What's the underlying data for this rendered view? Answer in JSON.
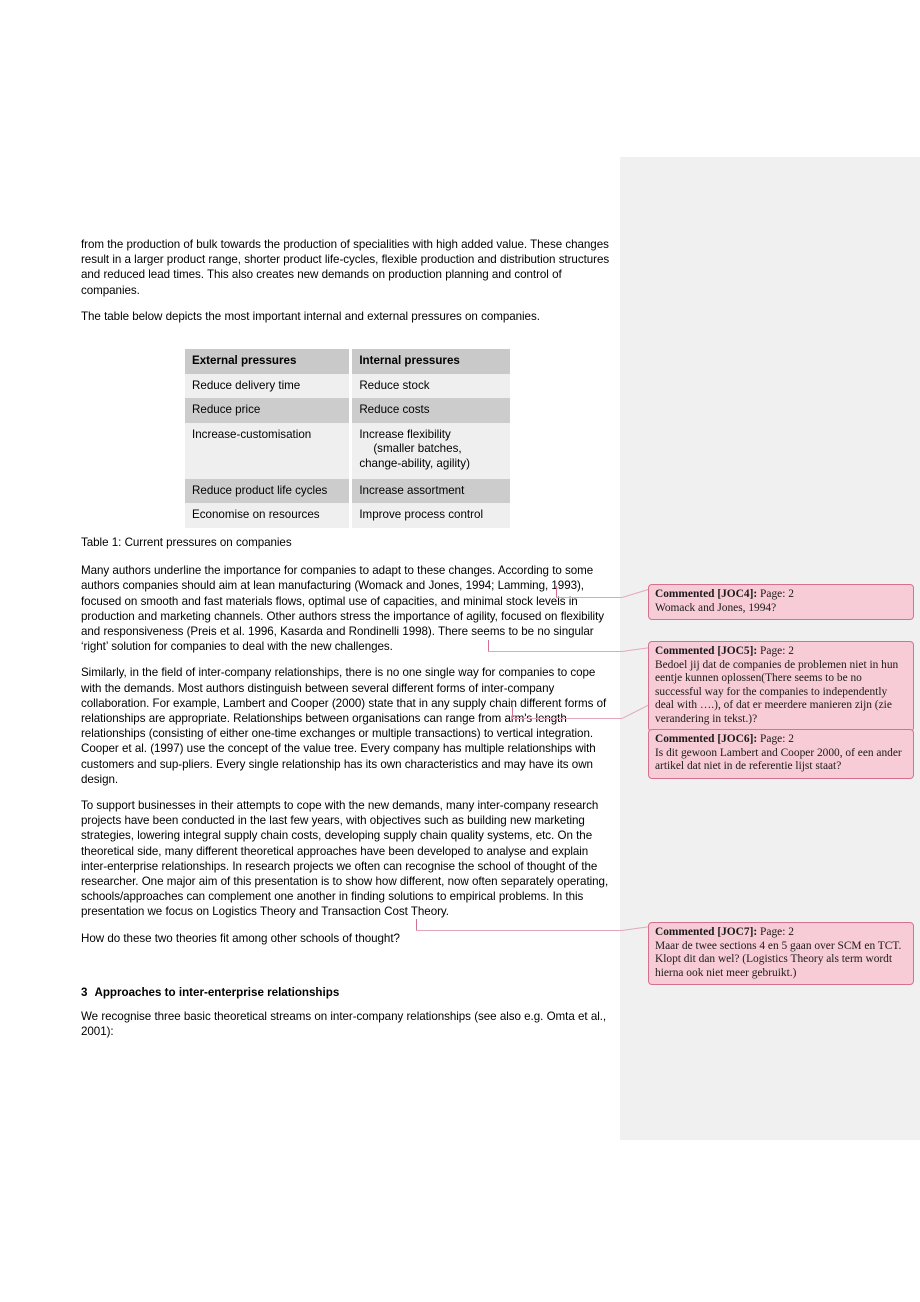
{
  "document": {
    "paragraphs": [
      {
        "id": "p-intro",
        "text": "from the production of bulk towards the production of specialities with high added value. These changes result in a larger product range, shorter product life-cycles, flexible production and distribution structures and reduced lead times. This also creates new demands on production planning and control of companies."
      },
      {
        "id": "p-table-intro",
        "text": "The table below depicts the most important internal and external pressures on companies."
      },
      {
        "id": "p-caption",
        "text": "Table 1: Current pressures on companies"
      },
      {
        "id": "p-authors",
        "text": "Many authors underline the importance for companies to adapt to these changes. According to some authors companies should aim at lean manufacturing (Womack and Jones, 1994; Lamming, 1993),  focused on smooth and fast materials flows, optimal use of capacities, and minimal stock levels in production and marketing channels. Other authors stress the importance of agility, focused on flexibility and responsiveness (Preis et al. 1996, Kasarda and Rondinelli 1998). There seems to be no singular ‘right’ solution for companies to deal with the new challenges."
      },
      {
        "id": "p-similarly",
        "text": "Similarly, in the field of inter-company relationships, there is no one single way  for companies to cope with the demands. Most authors distinguish between several different forms of inter-company collaboration. For example, Lambert and Cooper (2000) state that in any supply chain different forms of relationships are appropriate. Relationships between organisations can range from arm's length relationships (consisting of either one-time exchanges or multiple transactions) to vertical integration. Cooper et al. (1997) use the concept of the value tree. Every company has multiple relationships with customers and sup-pliers. Every single relationship has its own characteristics and may have its own design."
      },
      {
        "id": "p-support",
        "text": "To support businesses in their attempts to cope with the new demands, many inter-company research projects have been conducted in the last few years, with objectives such as building new marketing strategies, lowering integral supply chain costs, developing supply chain quality systems, etc. On the theoretical side, many different theoretical approaches have been developed to analyse and explain inter-enterprise relationships. In research projects we often can recognise the school of thought of the researcher. One major aim of this presentation is to show how different, now often separately operating, schools/approaches can complement one another in finding solutions to empirical problems.  In this presentation we focus on Logistics Theory and Transaction Cost Theory."
      },
      {
        "id": "p-howdo",
        "text": "How do  these two theories fit among other schools of thought?"
      },
      {
        "id": "p-recognise",
        "text": "We recognise three basic theoretical streams on inter-company relationships (see also e.g. Omta et al., 2001):"
      }
    ],
    "section_heading": {
      "number": "3",
      "title": "Approaches to inter-enterprise relationships"
    }
  },
  "table": {
    "caption": "Table 1: Current pressures on companies",
    "headers": [
      "External pressures",
      "Internal pressures"
    ],
    "rows": [
      {
        "external": "Reduce delivery time",
        "internal": "Reduce stock"
      },
      {
        "external": "Reduce price",
        "internal": "Reduce costs"
      },
      {
        "external": "Increase-customisation",
        "internal_line1": "Increase flexibility",
        "internal_line2": "(smaller batches,",
        "internal_line3": "change-ability, agility)"
      },
      {
        "external": "Reduce product life cycles",
        "internal": "Increase assortment"
      },
      {
        "external": "Economise on resources",
        "internal": "Improve process control"
      }
    ]
  },
  "comments": [
    {
      "id": "JOC4",
      "label": "Commented [JOC4]:",
      "page": "Page: 2",
      "body": "Womack and Jones, 1994?"
    },
    {
      "id": "JOC5",
      "label": "Commented [JOC5]:",
      "page": "Page: 2",
      "body": "Bedoel jij dat de companies de problemen niet in hun eentje kunnen oplossen(There seems to be no successful way for the companies to independently deal with ….), of dat er meerdere manieren zijn (zie verandering in tekst.)?"
    },
    {
      "id": "JOC6",
      "label": "Commented [JOC6]:",
      "page": "Page: 2",
      "body": "Is dit gewoon Lambert and Cooper 2000, of een ander artikel dat niet in de referentie lijst staat?"
    },
    {
      "id": "JOC7",
      "label": "Commented [JOC7]:",
      "page": "Page: 2",
      "body": "Maar de twee sections 4 en 5 gaan over SCM en TCT. Klopt dit dan wel? (Logistics Theory als term wordt hierna ook niet meer gebruikt.)"
    }
  ],
  "colors": {
    "review_panel_bg": "#f0f0f0",
    "comment_fill": "#f7ccd7",
    "comment_border": "#d4718f",
    "anchor_line": "#e4a7ba",
    "table_header_bg": "#c9c9c9",
    "table_row_light": "#efefef",
    "table_row_dark": "#cccccc",
    "page_bg": "#ffffff",
    "text": "#000000"
  }
}
